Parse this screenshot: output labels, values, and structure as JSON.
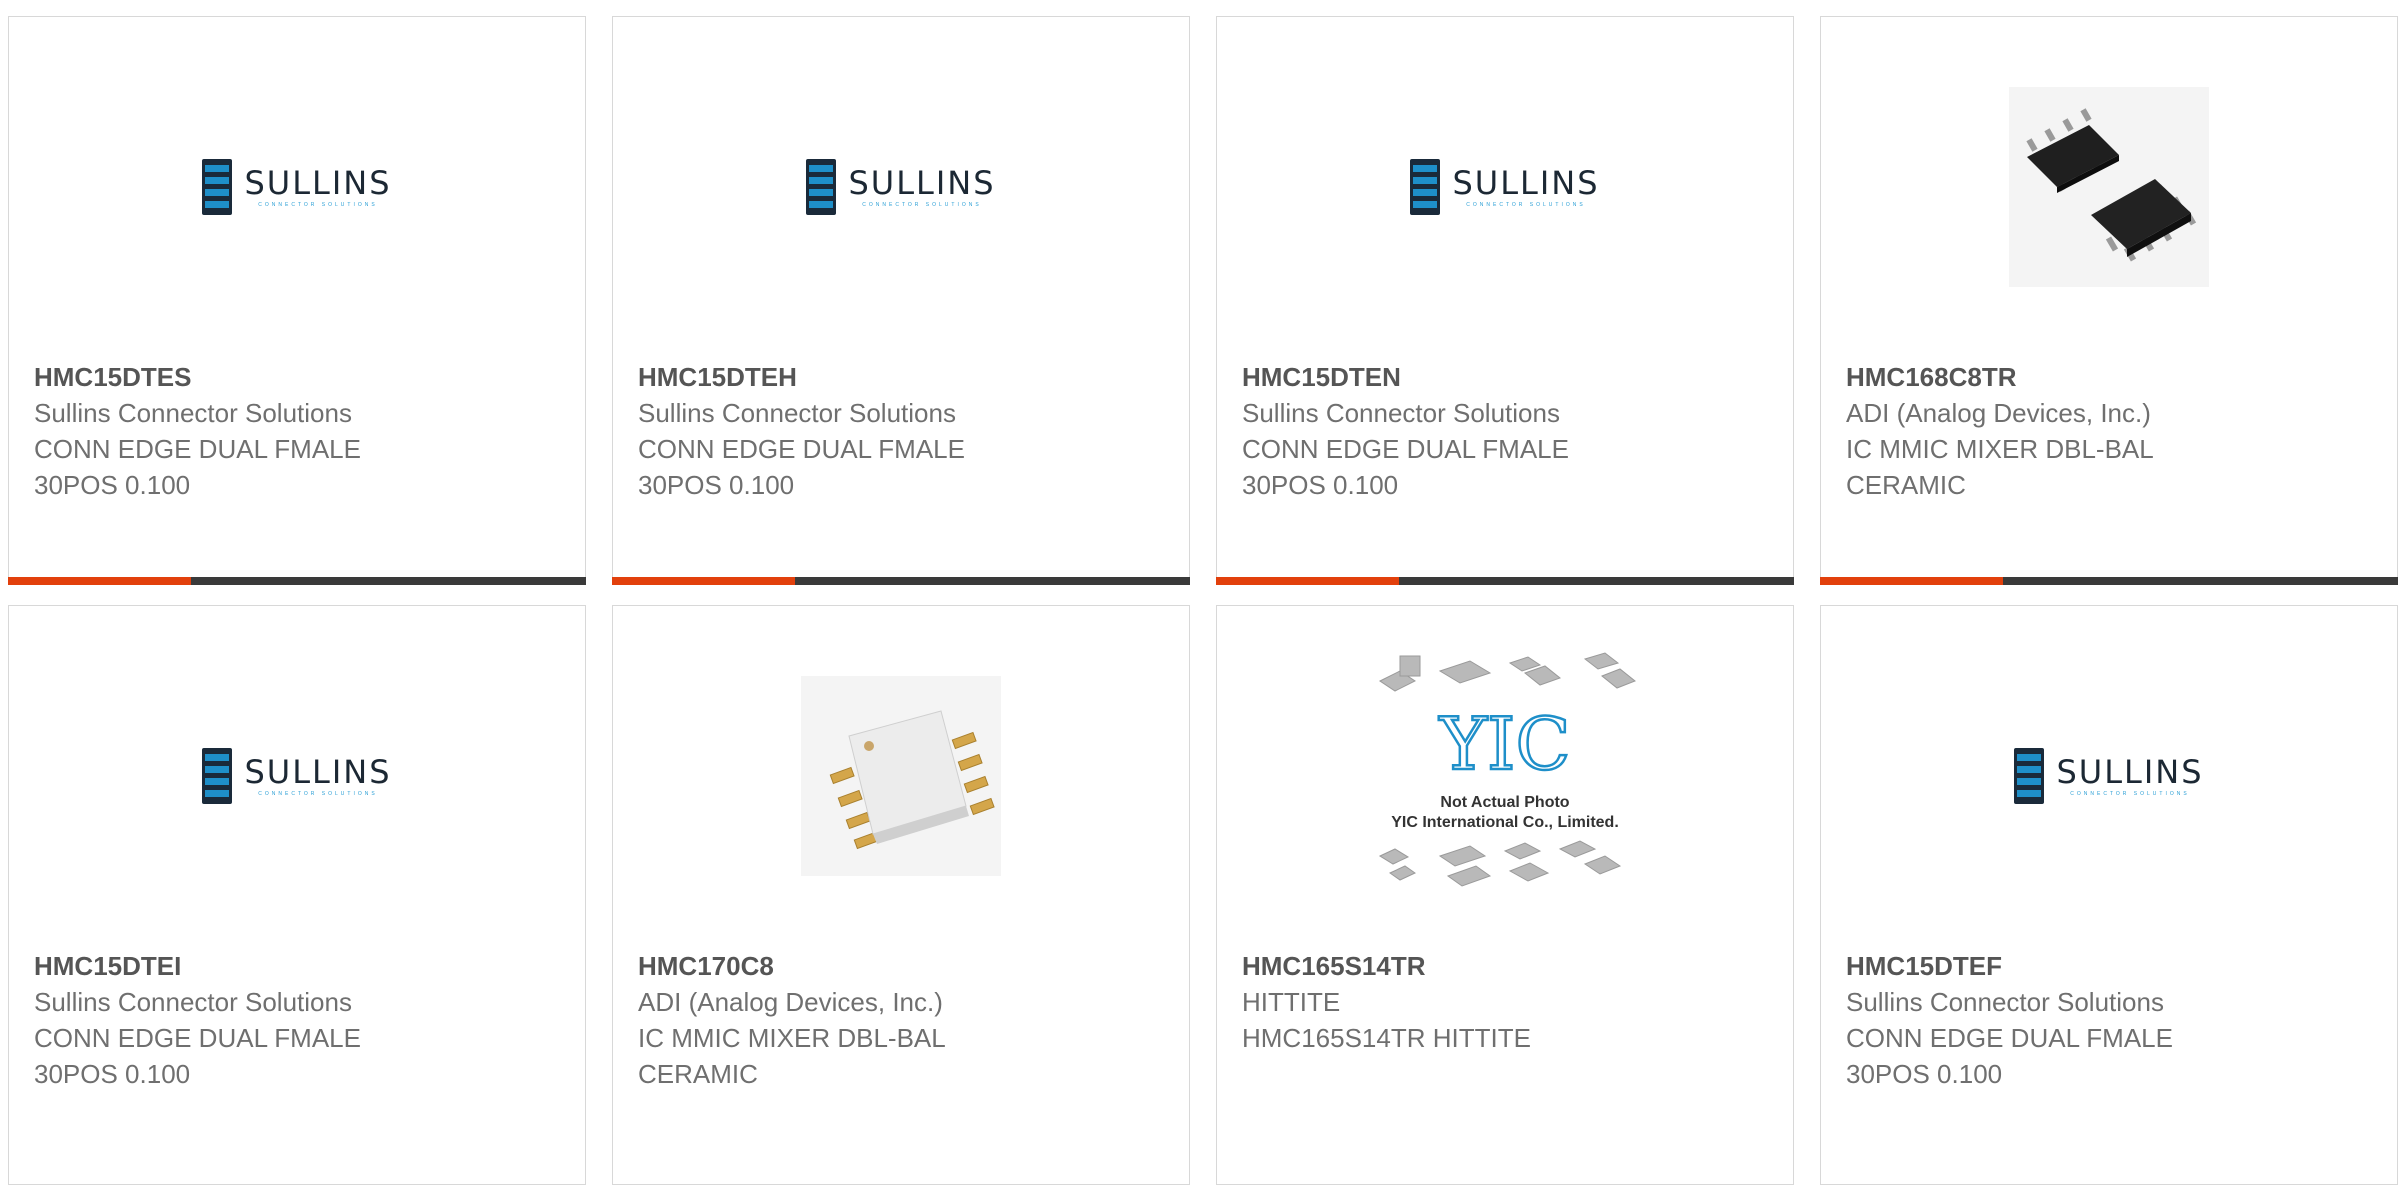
{
  "products": [
    {
      "part": "HMC15DTES",
      "manufacturer": "Sullins Connector Solutions",
      "description": "CONN EDGE DUAL FMALE 30POS 0.100",
      "image": "sullins-logo"
    },
    {
      "part": "HMC15DTEH",
      "manufacturer": "Sullins Connector Solutions",
      "description": "CONN EDGE DUAL FMALE 30POS 0.100",
      "image": "sullins-logo"
    },
    {
      "part": "HMC15DTEN",
      "manufacturer": "Sullins Connector Solutions",
      "description": "CONN EDGE DUAL FMALE 30POS 0.100",
      "image": "sullins-logo"
    },
    {
      "part": "HMC168C8TR",
      "manufacturer": "ADI (Analog Devices, Inc.)",
      "description": "IC MMIC MIXER DBL-BAL CERAMIC",
      "image": "soic-chip-photo"
    },
    {
      "part": "HMC15DTEI",
      "manufacturer": "Sullins Connector Solutions",
      "description": "CONN EDGE DUAL FMALE 30POS 0.100",
      "image": "sullins-logo"
    },
    {
      "part": "HMC170C8",
      "manufacturer": "ADI (Analog Devices, Inc.)",
      "description": "IC MMIC MIXER DBL-BAL CERAMIC",
      "image": "ceramic-chip-photo"
    },
    {
      "part": "HMC165S14TR",
      "manufacturer": "HITTITE",
      "description": "HMC165S14TR HITTITE",
      "image": "yic-placeholder"
    },
    {
      "part": "HMC15DTEF",
      "manufacturer": "Sullins Connector Solutions",
      "description": "CONN EDGE DUAL FMALE 30POS 0.100",
      "image": "sullins-logo"
    }
  ],
  "sullins_logo": {
    "word": "SULLINS",
    "sub": "CONNECTOR SOLUTIONS"
  },
  "yic_placeholder": {
    "logo": "YIC",
    "line1": "Not Actual Photo",
    "line2": "YIC International Co., Limited."
  },
  "colors": {
    "accent": "#e2400c",
    "bar": "#3a3a3a",
    "part_text": "#555555",
    "body_text": "#6f6f6f"
  }
}
